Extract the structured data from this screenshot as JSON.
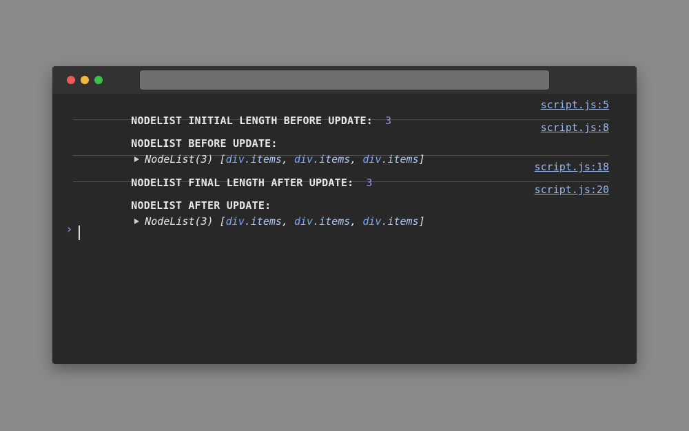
{
  "window": {
    "colors": {
      "close": "#ed5a55",
      "minimize": "#f0b83b",
      "maximize": "#36c247"
    }
  },
  "console": {
    "logs": [
      {
        "message": "NODELIST INITIAL LENGTH BEFORE UPDATE:",
        "value": "3",
        "source": "script.js:5"
      },
      {
        "message": "NODELIST BEFORE UPDATE:",
        "source": "script.js:8",
        "nodelist": {
          "prefix": "NodeList(3) [",
          "items": [
            {
              "tag": "div",
              "cls": ".items"
            },
            {
              "tag": "div",
              "cls": ".items"
            },
            {
              "tag": "div",
              "cls": ".items"
            }
          ],
          "suffix": "]"
        }
      },
      {
        "message": "NODELIST FINAL LENGTH AFTER UPDATE:",
        "value": "3",
        "source": "script.js:18"
      },
      {
        "message": "NODELIST AFTER UPDATE:",
        "source": "script.js:20",
        "nodelist": {
          "prefix": "NodeList(3) [",
          "items": [
            {
              "tag": "div",
              "cls": ".items"
            },
            {
              "tag": "div",
              "cls": ".items"
            },
            {
              "tag": "div",
              "cls": ".items"
            }
          ],
          "suffix": "]"
        }
      }
    ],
    "prompt_symbol": "›"
  }
}
